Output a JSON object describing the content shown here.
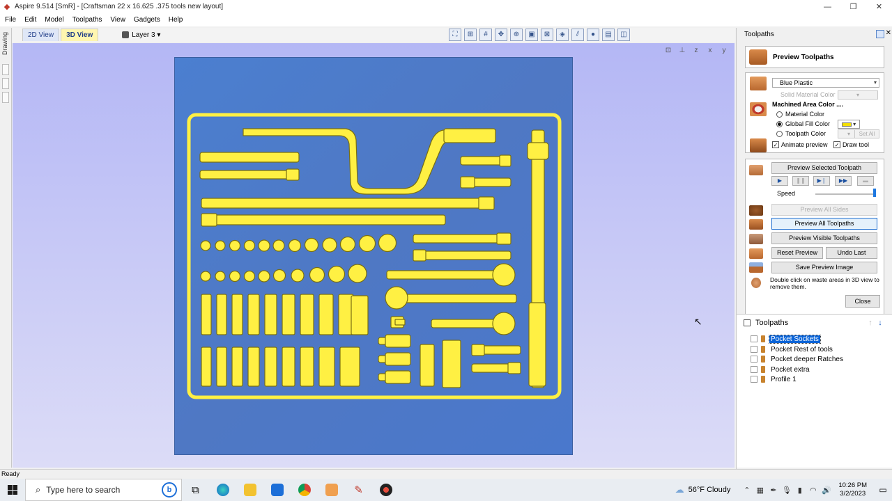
{
  "window": {
    "title": "Aspire 9.514 [SmR] - [Craftsman 22 x 16.625 .375 tools new layout]"
  },
  "menu": [
    "File",
    "Edit",
    "Model",
    "Toolpaths",
    "View",
    "Gadgets",
    "Help"
  ],
  "view_tabs": {
    "tab_2d": "2D View",
    "tab_3d": "3D View"
  },
  "layer": {
    "selected": "Layer 3"
  },
  "left_strip": {
    "label": "Drawing"
  },
  "colors": {
    "material_blue": "#4f7bcb",
    "pocket_yellow": "#fff043",
    "viewport_bg": "#c8c9f6",
    "selection_blue": "#0a64d8"
  },
  "right_panel": {
    "header": "Toolpaths",
    "preview_title": "Preview Toolpaths",
    "material": {
      "selected": "Blue Plastic",
      "solid_material_color": "Solid Material Color",
      "machined_area_heading": "Machined Area Color ....",
      "radio_material": "Material Color",
      "radio_global": "Global Fill Color",
      "radio_toolpath": "Toolpath Color",
      "set_all": "Set All",
      "animate_preview": "Animate preview",
      "draw_tool": "Draw tool"
    },
    "preview": {
      "preview_selected": "Preview Selected Toolpath",
      "speed_label": "Speed",
      "preview_all_sides": "Preview All Sides",
      "preview_all": "Preview All Toolpaths",
      "preview_visible": "Preview Visible Toolpaths",
      "reset_preview": "Reset Preview",
      "undo_last": "Undo Last",
      "save_preview": "Save Preview Image",
      "note": "Double click on waste areas in 3D view to remove them."
    },
    "close": "Close",
    "toolpaths_section": {
      "heading": "Toolpaths",
      "items": [
        {
          "name": "Pocket Sockets",
          "selected": true
        },
        {
          "name": "Pocket Rest of tools",
          "selected": false
        },
        {
          "name": "Pocket deeper Ratches",
          "selected": false
        },
        {
          "name": "Pocket extra",
          "selected": false
        },
        {
          "name": "Profile 1",
          "selected": false
        }
      ]
    }
  },
  "statusbar": {
    "text": "Ready"
  },
  "taskbar": {
    "search_placeholder": "Type here to search",
    "weather": "56°F  Cloudy",
    "time": "10:26 PM",
    "date": "3/2/2023"
  }
}
